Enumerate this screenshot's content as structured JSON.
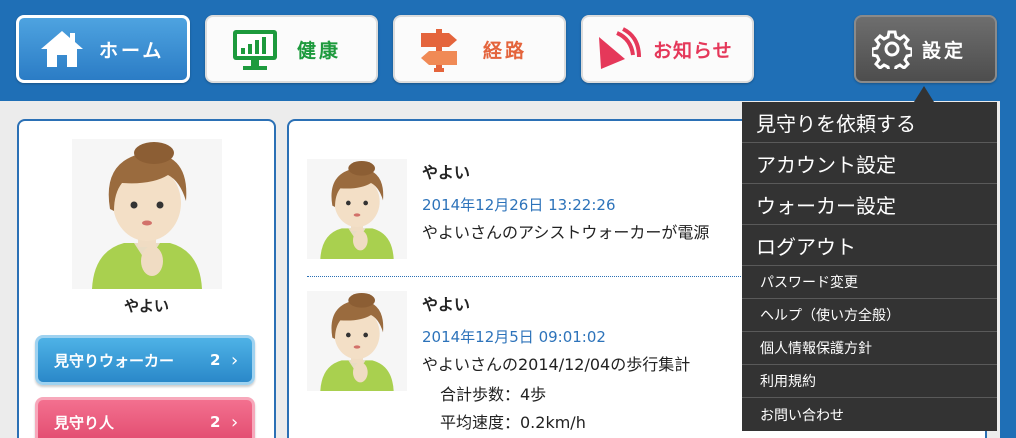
{
  "nav": {
    "home_label": "ホーム",
    "health_label": "健康",
    "route_label": "経路",
    "news_label": "お知らせ",
    "settings_label": "設定"
  },
  "profile": {
    "name": "やよい",
    "watch_walker_label": "見守りウォーカー",
    "watch_walker_count": "2",
    "watchers_label": "見守り人",
    "watchers_count": "2",
    "chevron": "›"
  },
  "feed": [
    {
      "user": "やよい",
      "time": "2014年12月26日 13:22:26",
      "message": "やよいさんのアシストウォーカーが電源"
    },
    {
      "user": "やよい",
      "time": "2014年12月5日 09:01:02",
      "message": "やよいさんの2014/12/04の歩行集計",
      "detail1": "合計歩数：4歩",
      "detail2": "平均速度：0.2km/h"
    }
  ],
  "settings_menu": {
    "items_large": [
      "見守りを依頼する",
      "アカウント設定",
      "ウォーカー設定",
      "ログアウト"
    ],
    "items_small": [
      "パスワード変更",
      "ヘルプ（使い方全般）",
      "個人情報保護方針",
      "利用規約",
      "お問い合わせ"
    ]
  },
  "colors": {
    "header_blue": "#1f6fb6",
    "health_green": "#1d9a3d",
    "route_orange": "#e4643c",
    "news_pink": "#e5385a",
    "timestamp_blue": "#2d73ba",
    "menu_dark": "#333333"
  },
  "icons": [
    "house-icon",
    "monitor-chart-icon",
    "signpost-icon",
    "megaphone-icon",
    "gear-icon"
  ]
}
